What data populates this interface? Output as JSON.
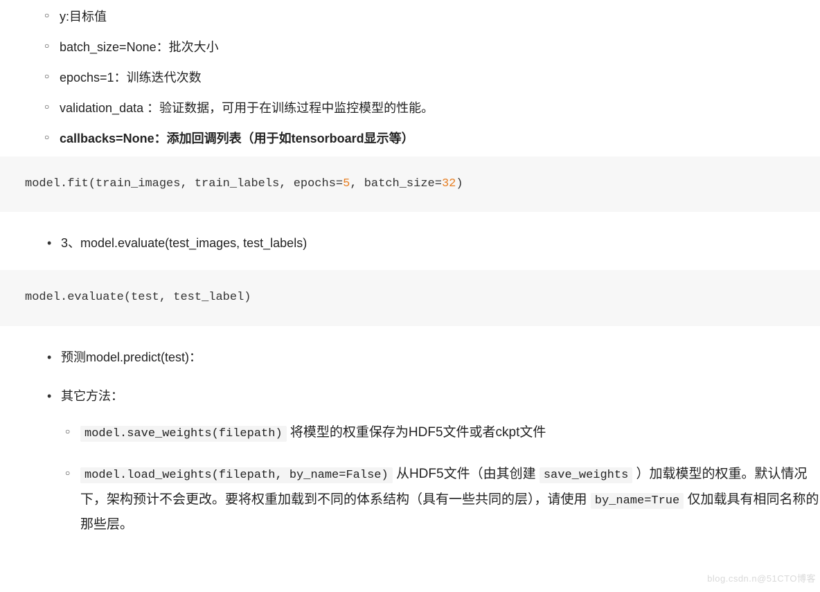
{
  "params": {
    "y": "y:目标值",
    "batch_size": "batch_size=None：批次大小",
    "epochs": "epochs=1：训练迭代次数",
    "validation_data": "validation_data ：验证数据，可用于在训练过程中监控模型的性能。",
    "callbacks": "callbacks=None：添加回调列表（用于如tensorboard显示等）"
  },
  "code1": {
    "p1": "model",
    "p2": ".",
    "p3": "fit",
    "p4": "(",
    "p5": "train_images",
    "p6": ", ",
    "p7": "train_labels",
    "p8": ", ",
    "p9": "epochs",
    "p10": "=",
    "p11": "5",
    "p12": ", ",
    "p13": "batch_size",
    "p14": "=",
    "p15": "32",
    "p16": ")"
  },
  "section3": "3、model.evaluate(test_images, test_labels)",
  "code2": {
    "p1": "model",
    "p2": ".",
    "p3": "evaluate",
    "p4": "(",
    "p5": "test",
    "p6": ", ",
    "p7": "test_label",
    "p8": ")"
  },
  "predict": "预测model.predict(test)：",
  "other_methods": "其它方法：",
  "save_weights": {
    "code": "model.save_weights(filepath)",
    "text": " 将模型的权重保存为HDF5文件或者ckpt文件"
  },
  "load_weights": {
    "code1": "model.load_weights(filepath, by_name=False)",
    "text1": " 从HDF5文件（由其创建 ",
    "code2": "save_weights",
    "text2": " ）加载模型的权重。默认情况下，架构预计不会更改。要将权重加载到不同的体系结构（具有一些共同的层），请使用 ",
    "code3": "by_name=True",
    "text3": " 仅加载具有相同名称的那些层。"
  },
  "watermark": "blog.csdn.n@51CTO博客"
}
